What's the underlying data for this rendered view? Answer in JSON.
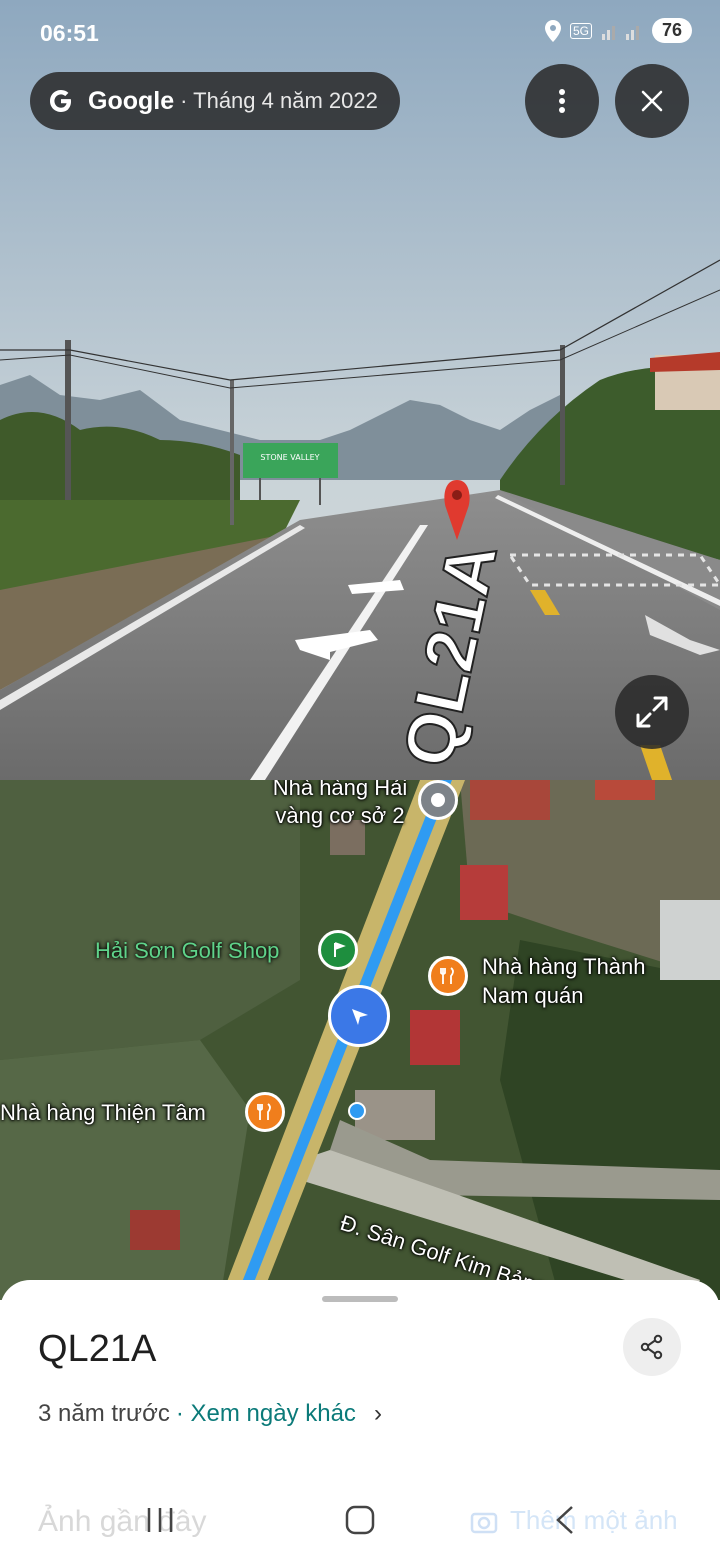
{
  "status_bar": {
    "time": "06:51",
    "network": "5G",
    "battery": "76"
  },
  "source_chip": {
    "brand": "Google",
    "date": "· Tháng 4 năm 2022"
  },
  "streetview": {
    "road_marking": "QL21A",
    "sign_text": "STONE VALLEY"
  },
  "map": {
    "labels": {
      "restaurant_hai": "Nhà hàng Hải vàng cơ sở 2",
      "golf_shop": "Hải Sơn Golf Shop",
      "restaurant_thanh_nam_1": "Nhà hàng Thành",
      "restaurant_thanh_nam_2": "Nam quán",
      "restaurant_thien_tam": "Nhà hàng Thiện Tâm",
      "road_golf": "Đ. Sân Golf Kim Bảng"
    }
  },
  "sheet": {
    "title": "QL21A",
    "age": "3 năm trước",
    "link": "· Xem ngày khác",
    "recent_photos": "Ảnh gần đây",
    "add_photo": "Thêm một ảnh"
  },
  "colors": {
    "route": "#2f9bf2",
    "poi_orange": "#f07e1c",
    "poi_green": "#1e8e3e",
    "link": "#0b7a79"
  }
}
